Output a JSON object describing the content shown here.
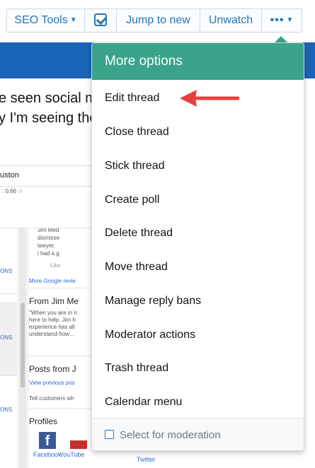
{
  "toolbar": {
    "seo_tools_label": "SEO Tools",
    "jump_to_new_label": "Jump to new",
    "unwatch_label": "Unwatch",
    "more_label": "•••"
  },
  "background": {
    "text_line_1": "e seen social me",
    "text_line_2": "y I'm seeing ther",
    "screenshot": {
      "search_text": "uston",
      "da_text": ": 0.66 ☆",
      "left_links": [
        "ONS",
        "ONS",
        "ONS"
      ],
      "panel": {
        "review_lines": [
          "Jim Med",
          "dismisse",
          "lawyer.",
          "i had a g"
        ],
        "like_label": "Like",
        "more_reviews_link": "More Google revie",
        "from_heading": "From Jim Me",
        "quote_lines": [
          "\"When you are in n",
          "here to help. Jim h",
          "experience has all",
          "understand how…"
        ],
        "posts_heading": "Posts from J",
        "view_previous_link": "View previous pos",
        "tell_customers": "Tell customers wh",
        "profiles_heading": "Profiles",
        "social": [
          "Facebook",
          "YouTube",
          "Twitter"
        ]
      }
    }
  },
  "menu": {
    "title": "More options",
    "items": [
      "Edit thread",
      "Close thread",
      "Stick thread",
      "Create poll",
      "Delete thread",
      "Move thread",
      "Manage reply bans",
      "Moderator actions",
      "Trash thread",
      "Calendar menu"
    ],
    "footer_label": "Select for moderation",
    "header_color": "#3aa38a"
  },
  "annotation": {
    "arrow_color": "#e8403a",
    "points_to": "Edit thread"
  }
}
